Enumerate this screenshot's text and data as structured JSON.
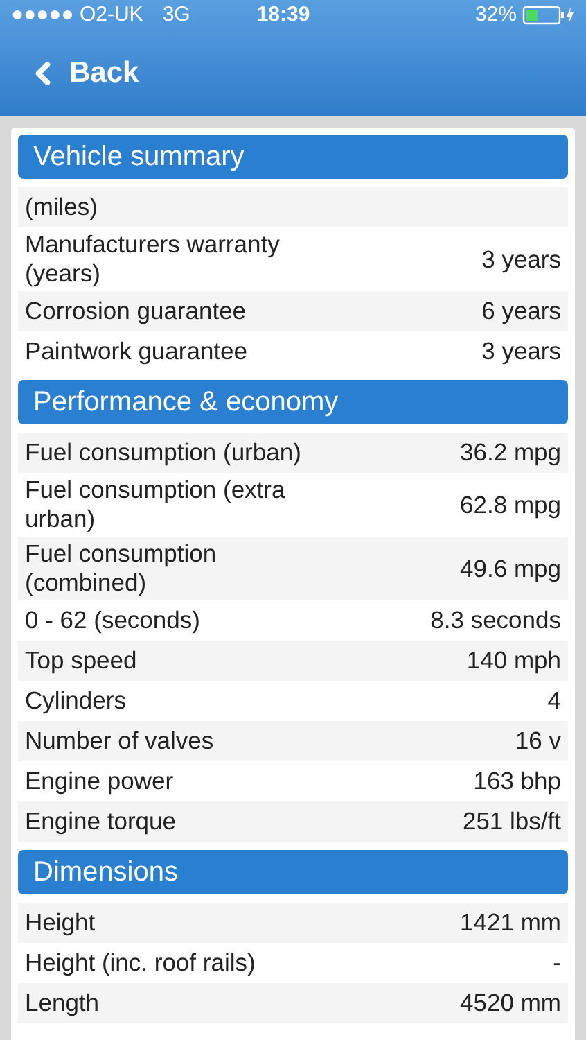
{
  "status_bar": {
    "carrier": "●●●●● O2-UK",
    "network": "3G",
    "time": "18:39",
    "battery": "32%"
  },
  "nav": {
    "back": "Back"
  },
  "sections": [
    {
      "title": "Vehicle summary",
      "rows": [
        {
          "label": "(miles)",
          "value": ""
        },
        {
          "label": "Manufacturers warranty (years)",
          "value": "3 years"
        },
        {
          "label": "Corrosion guarantee",
          "value": "6 years"
        },
        {
          "label": "Paintwork guarantee",
          "value": "3 years"
        }
      ]
    },
    {
      "title": "Performance & economy",
      "rows": [
        {
          "label": "Fuel consumption (urban)",
          "value": "36.2 mpg"
        },
        {
          "label": "Fuel consumption (extra urban)",
          "value": "62.8 mpg"
        },
        {
          "label": "Fuel consumption (combined)",
          "value": "49.6 mpg"
        },
        {
          "label": "0 - 62 (seconds)",
          "value": "8.3 seconds"
        },
        {
          "label": "Top speed",
          "value": "140 mph"
        },
        {
          "label": "Cylinders",
          "value": "4"
        },
        {
          "label": "Number of valves",
          "value": "16 v"
        },
        {
          "label": "Engine power",
          "value": "163 bhp"
        },
        {
          "label": "Engine torque",
          "value": "251 lbs/ft"
        }
      ]
    },
    {
      "title": "Dimensions",
      "rows": [
        {
          "label": "Height",
          "value": "1421 mm"
        },
        {
          "label": "Height (inc. roof rails)",
          "value": "-"
        },
        {
          "label": "Length",
          "value": "4520 mm"
        }
      ]
    }
  ]
}
